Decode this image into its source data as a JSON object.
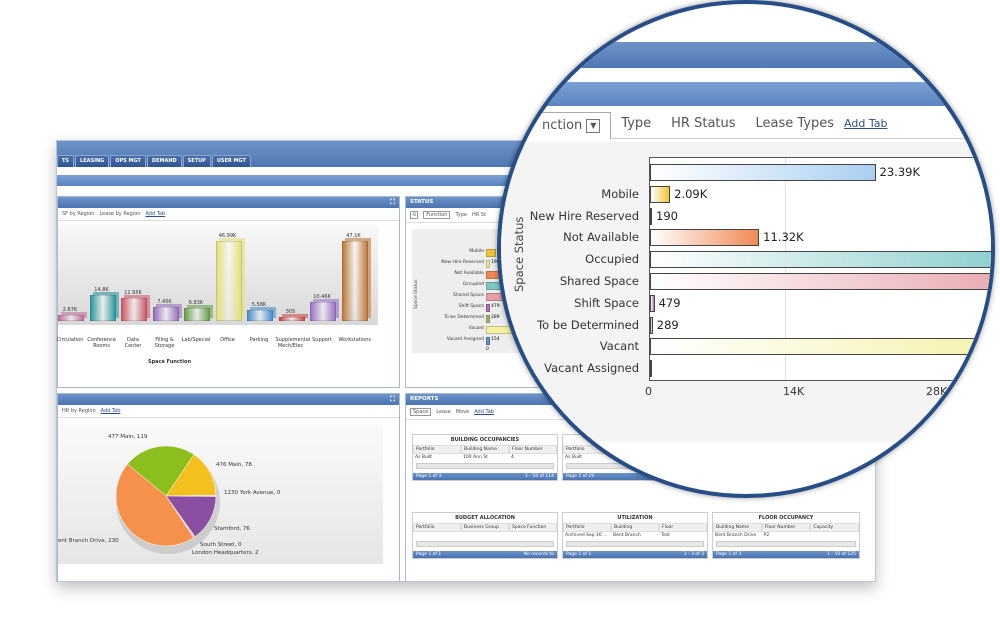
{
  "nav_tabs": [
    "TS",
    "LEASING",
    "OPS MGT",
    "DEMAND",
    "SETUP",
    "USER MGT"
  ],
  "panel_space": {
    "tabs": [
      "SF by Region",
      "Lease by Region"
    ],
    "add_tab": "Add Tab",
    "x_title": "Space Function",
    "bars": [
      {
        "label": "Circulation",
        "value": "2.67K",
        "color": "#c070a0"
      },
      {
        "label": "Conference Rooms",
        "value": "14.8K",
        "color": "#2e9aa0"
      },
      {
        "label": "Data Center",
        "value": "12.95K",
        "color": "#d05a6a"
      },
      {
        "label": "Filing & Storage",
        "value": "7.45K",
        "color": "#9a6fc0"
      },
      {
        "label": "Lab/Special",
        "value": "6.83K",
        "color": "#6aa04a"
      },
      {
        "label": "Office",
        "value": "46.99K",
        "color": "#e4e07a"
      },
      {
        "label": "Parking",
        "value": "5.58K",
        "color": "#4a8fd0"
      },
      {
        "label": "Supplemental Mech/Elec",
        "value": "305",
        "color": "#d04a4a"
      },
      {
        "label": "Support",
        "value": "10.46K",
        "color": "#9a74c8"
      },
      {
        "label": "Workstations",
        "value": "47.1K",
        "color": "#c07a3a"
      }
    ],
    "bar_values": [
      2.67,
      14.8,
      12.95,
      7.45,
      6.83,
      46.99,
      5.58,
      0.305,
      10.46,
      47.1
    ]
  },
  "panel_status": {
    "title": "STATUS",
    "tabs": [
      "Function",
      "Type",
      "HR St"
    ],
    "y_title": "Space Status",
    "rows": [
      "Mobile",
      "New Hire Reserved",
      "Not Available",
      "Occupied",
      "Shared Space",
      "Shift Space",
      "To be Determined",
      "Vacant",
      "Vacant Assigned"
    ],
    "small_vals": [
      "190",
      "479",
      "289",
      "154"
    ],
    "axis0": "0"
  },
  "panel_pie": {
    "tabs": [
      "HR by Region"
    ],
    "add_tab": "Add Tab",
    "labels": [
      "477 Main, 119",
      "476 Main, 78",
      "1230 York Avenue, 0",
      "Stamford, 76",
      "South Street, 0",
      "London Headquarters, 2",
      "ent Branch Drive, 230"
    ]
  },
  "panel_reports": {
    "title": "REPORTS",
    "tabs": [
      "Space",
      "Lease",
      "Move"
    ],
    "add_tab": "Add Tab",
    "tables": [
      {
        "title": "BUILDING OCCUPANCIES",
        "cols": [
          "Portfolio",
          "Building Name",
          "Floor Number"
        ],
        "row": [
          "As Built",
          "100 Ann St",
          "4"
        ],
        "pager": "Page 1 of 3",
        "count": "1 - 50 of 114"
      },
      {
        "title": "",
        "cols": [
          "Portfolio"
        ],
        "row": [
          "As Built"
        ],
        "pager": "Page 1 of 19",
        "count": "17 of 17"
      },
      {
        "title": "BUDGET ALLOCATION",
        "cols": [
          "Portfolio",
          "Business Group",
          "Space Function"
        ],
        "row": [
          "",
          "",
          ""
        ],
        "pager": "Page 1 of 1",
        "count": "No records to"
      },
      {
        "title": "UTILIZATION",
        "cols": [
          "Portfolio",
          "Building",
          "Floor"
        ],
        "row": [
          "Archived Sep 16 ...",
          "Bent Branch",
          "Test"
        ],
        "pager": "Page 1 of 1",
        "count": "1 - 3 of 3"
      },
      {
        "title": "FLOOR OCCUPANCY",
        "cols": [
          "Building Name",
          "Floor Number",
          "Capacity"
        ],
        "row": [
          "Bent Branch Drive",
          "P2",
          ""
        ],
        "pager": "Page 1 of 3",
        "count": "1 - 50 of 125"
      }
    ]
  },
  "magnifier": {
    "tabs": [
      "nction",
      "Type",
      "HR Status",
      "Lease Types"
    ],
    "add_tab": "Add Tab",
    "y_title": "Space Status",
    "ticks": [
      "0",
      "14K",
      "28K"
    ],
    "chart_data": {
      "type": "bar",
      "orientation": "horizontal",
      "categories": [
        "",
        "Mobile",
        "New Hire Reserved",
        "Not Available",
        "Occupied",
        "Shared Space",
        "Shift Space",
        "To be Determined",
        "Vacant",
        "Vacant Assigned"
      ],
      "labels": [
        "23.39K",
        "2.09K",
        "190",
        "11.32K",
        "",
        "",
        "479",
        "289",
        "",
        "",
        " "
      ],
      "values": [
        23390,
        2090,
        190,
        11320,
        48000,
        48000,
        479,
        289,
        48000,
        154
      ],
      "colors": [
        "#a9cff0",
        "#f0c43a",
        "#e6e6a0",
        "#f08a55",
        "#7ec8c8",
        "#e6a0a8",
        "#b070b0",
        "#9ab86a",
        "#f4f0a0",
        "#6a8fc0"
      ],
      "xlim": [
        0,
        28000
      ],
      "ylabel": "Space Status"
    }
  }
}
